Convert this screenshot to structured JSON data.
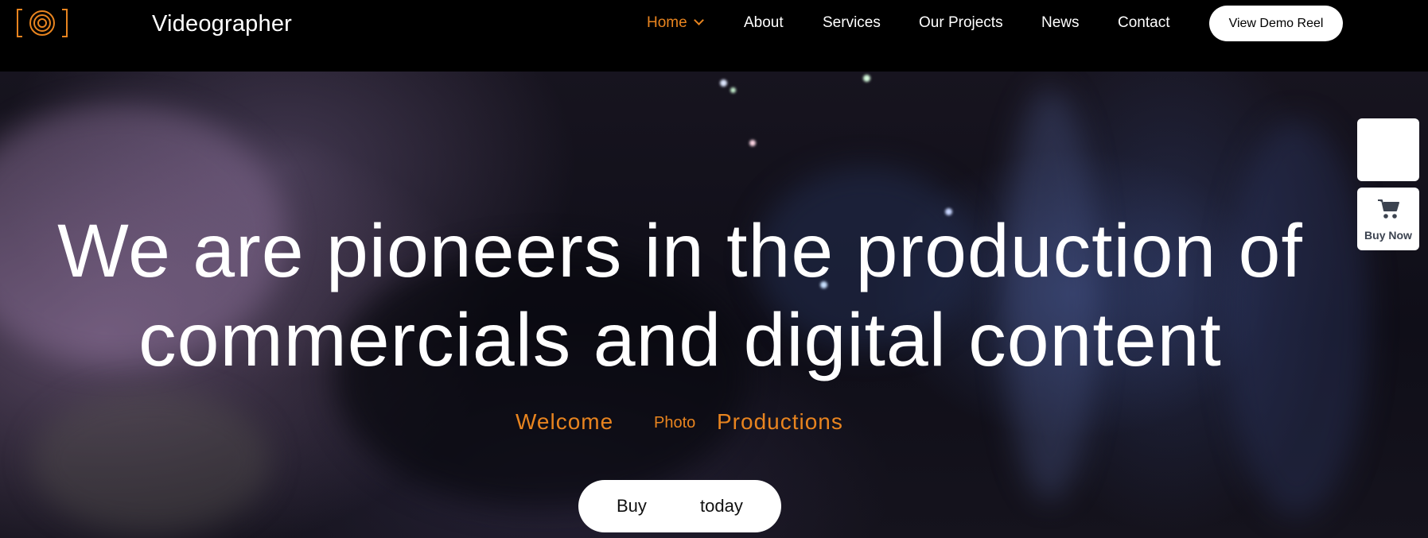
{
  "header": {
    "brand": "Videographer",
    "nav": [
      {
        "label": "Home",
        "active": true
      },
      {
        "label": "About"
      },
      {
        "label": "Services"
      },
      {
        "label": "Our Projects"
      },
      {
        "label": "News"
      },
      {
        "label": "Contact"
      }
    ],
    "cta_label": "View Demo Reel"
  },
  "hero": {
    "headline_line1": "We are pioneers in the production of",
    "headline_line2": "commercials and digital content",
    "subwords": [
      "Welcome",
      "Photo",
      "Productions"
    ],
    "button_words": [
      "Buy",
      "today"
    ]
  },
  "side_widget": {
    "buy_now_label": "Buy Now"
  },
  "colors": {
    "accent": "#e8841f",
    "background": "#000000",
    "text": "#ffffff"
  },
  "icons": {
    "logo": "camera-lens-icon",
    "cart": "shopping-cart-icon",
    "nav_dropdown": "chevron-down-icon"
  }
}
